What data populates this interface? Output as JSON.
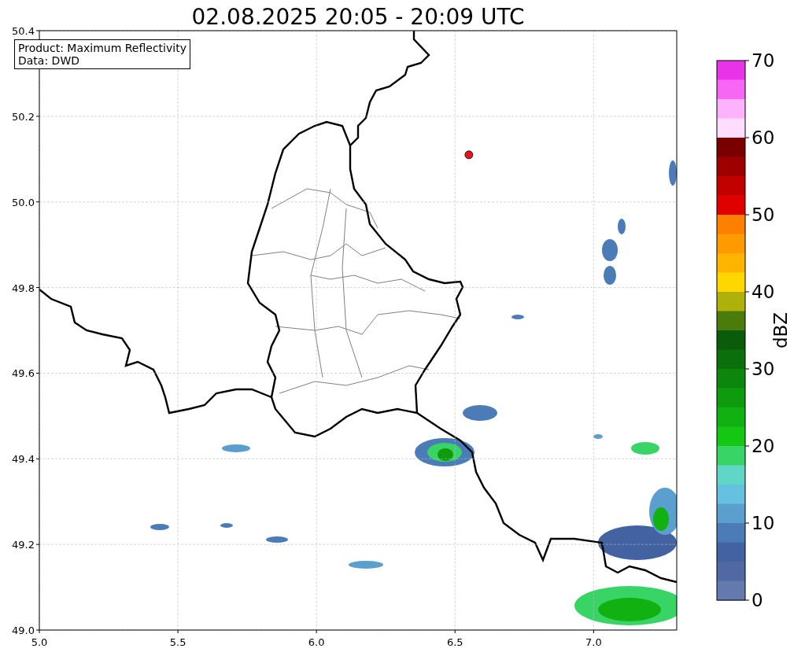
{
  "title": "02.08.2025 20:05 - 20:09 UTC",
  "plot": {
    "info_box": [
      "Product: Maximum Reflectivity",
      "Data: DWD"
    ],
    "chart_data": {
      "type": "scatter",
      "xlim": [
        5.0,
        7.3
      ],
      "ylim": [
        49.0,
        50.4
      ],
      "grid": true,
      "xticks": [
        {
          "value": 5.0,
          "label": "5.0"
        },
        {
          "value": 5.5,
          "label": "5.5"
        },
        {
          "value": 6.0,
          "label": "6.0"
        },
        {
          "value": 6.5,
          "label": "6.5"
        },
        {
          "value": 7.0,
          "label": "7.0"
        }
      ],
      "yticks": [
        {
          "value": 50.4,
          "label": "50.4"
        },
        {
          "value": 50.2,
          "label": "50.2"
        },
        {
          "value": 50.0,
          "label": "50.0"
        },
        {
          "value": 49.8,
          "label": "49.8"
        },
        {
          "value": 49.6,
          "label": "49.6"
        },
        {
          "value": 49.4,
          "label": "49.4"
        },
        {
          "value": 49.2,
          "label": "49.2"
        },
        {
          "value": 49.0,
          "label": "49.0"
        }
      ],
      "x": [
        6.55
      ],
      "series": [
        {
          "color": "#e8141b",
          "values": [
            50.11
          ]
        }
      ]
    }
  },
  "colorbar": {
    "label": "dBZ",
    "ticks": [
      "70",
      "60",
      "50",
      "40",
      "30",
      "20",
      "10",
      "0"
    ],
    "bands": [
      {
        "color": "#e933e9"
      },
      {
        "color": "#f766f4"
      },
      {
        "color": "#fcb3fb"
      },
      {
        "color": "#ffddff"
      },
      {
        "color": "#7a0000"
      },
      {
        "color": "#9e0000"
      },
      {
        "color": "#c20000"
      },
      {
        "color": "#e00000"
      },
      {
        "color": "#ff7f00"
      },
      {
        "color": "#ff9a00"
      },
      {
        "color": "#ffb400"
      },
      {
        "color": "#ffd700"
      },
      {
        "color": "#b0b00b"
      },
      {
        "color": "#4b7c0b"
      },
      {
        "color": "#0a5b0a"
      },
      {
        "color": "#0b700b"
      },
      {
        "color": "#0d860d"
      },
      {
        "color": "#0e9b0e"
      },
      {
        "color": "#10b110"
      },
      {
        "color": "#13c713"
      },
      {
        "color": "#38d466"
      },
      {
        "color": "#5fd6c6"
      },
      {
        "color": "#66c1e0"
      },
      {
        "color": "#5a9fce"
      },
      {
        "color": "#4c7cb8"
      },
      {
        "color": "#4362a2"
      },
      {
        "color": "#5068a3"
      },
      {
        "color": "#6479ad"
      }
    ]
  }
}
